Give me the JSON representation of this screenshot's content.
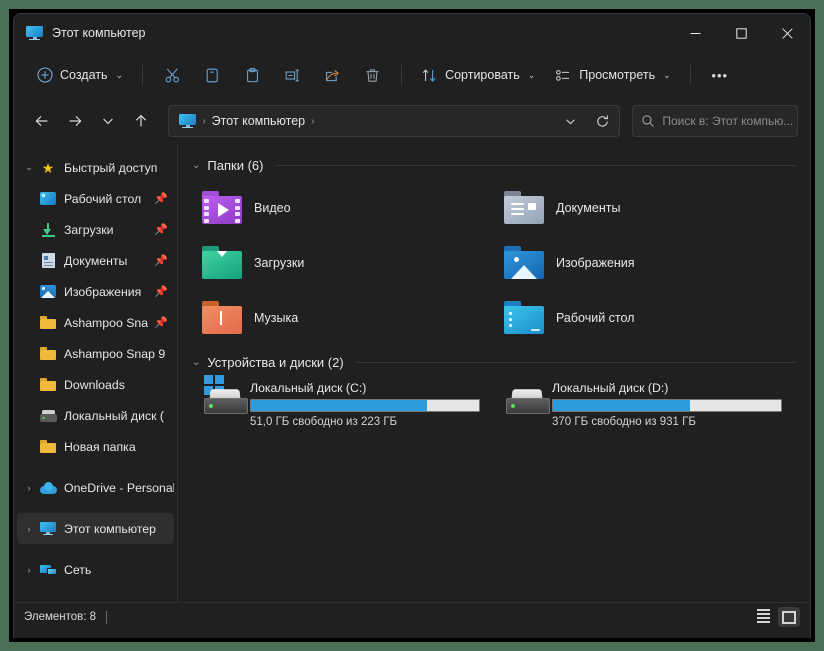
{
  "window": {
    "title": "Этот компьютер",
    "title_icon": "monitor-icon",
    "controls": {
      "minimize": "minimize-icon",
      "maximize": "maximize-icon",
      "close": "close-icon"
    },
    "accent": "#2d9cdb",
    "background": "#202020",
    "frame_color": "#4a7055"
  },
  "toolbar": {
    "new_label": "Создать",
    "new_icon": "plus-circle-icon",
    "cut_icon": "scissors-icon",
    "copy_icon": "copy-icon",
    "paste_icon": "clipboard-icon",
    "rename_icon": "rename-icon",
    "share_icon": "share-icon",
    "delete_icon": "trash-icon",
    "sort_label": "Сортировать",
    "sort_icon": "sort-arrows-icon",
    "view_label": "Просмотреть",
    "view_icon": "view-list-icon",
    "more_label": "•••"
  },
  "address": {
    "back_icon": "arrow-left-icon",
    "forward_icon": "arrow-right-icon",
    "recent_icon": "chevron-down-icon",
    "up_icon": "arrow-up-icon",
    "crumb_icon": "monitor-icon",
    "crumb_label": "Этот компьютер",
    "dropdown_icon": "chevron-down-icon",
    "refresh_icon": "refresh-icon"
  },
  "search": {
    "icon": "search-icon",
    "placeholder": "Поиск в: Этот компью..."
  },
  "sidebar": {
    "items": [
      {
        "label": "Быстрый доступ",
        "icon": "star-icon",
        "expanded": true,
        "chevron": "⌄",
        "pinned": false,
        "indent": 0,
        "selected": false
      },
      {
        "label": "Рабочий стол",
        "icon": "desktop-icon",
        "pinned": true,
        "indent": 1,
        "selected": false
      },
      {
        "label": "Загрузки",
        "icon": "download-icon",
        "pinned": true,
        "indent": 1,
        "selected": false
      },
      {
        "label": "Документы",
        "icon": "document-icon",
        "pinned": true,
        "indent": 1,
        "selected": false
      },
      {
        "label": "Изображения",
        "icon": "pictures-icon",
        "pinned": true,
        "indent": 1,
        "selected": false
      },
      {
        "label": "Ashampoo Sna",
        "icon": "folder-icon",
        "pinned": true,
        "indent": 1,
        "selected": false
      },
      {
        "label": "Ashampoo Snap 9",
        "icon": "folder-icon",
        "pinned": false,
        "indent": 1,
        "selected": false
      },
      {
        "label": "Downloads",
        "icon": "folder-icon",
        "pinned": false,
        "indent": 1,
        "selected": false
      },
      {
        "label": "Локальный диск (",
        "icon": "drive-icon",
        "pinned": false,
        "indent": 1,
        "selected": false
      },
      {
        "label": "Новая папка",
        "icon": "folder-icon",
        "pinned": false,
        "indent": 1,
        "selected": false
      },
      {
        "label": "OneDrive - Personal",
        "icon": "cloud-icon",
        "chevron": "›",
        "pinned": false,
        "indent": 0,
        "selected": false
      },
      {
        "label": "Этот компьютер",
        "icon": "monitor-icon",
        "chevron": "›",
        "pinned": false,
        "indent": 0,
        "selected": true
      },
      {
        "label": "Сеть",
        "icon": "network-icon",
        "chevron": "›",
        "pinned": false,
        "indent": 0,
        "selected": false
      }
    ]
  },
  "content": {
    "folders_group": {
      "title": "Папки (6)",
      "chevron": "⌄"
    },
    "folders": [
      {
        "label": "Видео",
        "icon": "folder-video-icon"
      },
      {
        "label": "Документы",
        "icon": "folder-documents-icon"
      },
      {
        "label": "Загрузки",
        "icon": "folder-downloads-icon"
      },
      {
        "label": "Изображения",
        "icon": "folder-pictures-icon"
      },
      {
        "label": "Музыка",
        "icon": "folder-music-icon"
      },
      {
        "label": "Рабочий стол",
        "icon": "folder-desktop-icon"
      }
    ],
    "drives_group": {
      "title": "Устройства и диски (2)",
      "chevron": "⌄"
    },
    "drives": [
      {
        "label": "Локальный диск (C:)",
        "icon": "hdd-windows-icon",
        "capacity_text": "51,0 ГБ свободно из 223 ГБ",
        "used_percent": 77,
        "bar_color": "#2d9cdb"
      },
      {
        "label": "Локальный диск (D:)",
        "icon": "hdd-icon",
        "capacity_text": "370 ГБ свободно из 931 ГБ",
        "used_percent": 60,
        "bar_color": "#2d9cdb"
      }
    ]
  },
  "statusbar": {
    "items_count": "Элементов: 8",
    "details_view_icon": "details-view-icon",
    "tiles_view_icon": "tiles-view-icon",
    "active_view": "tiles"
  }
}
